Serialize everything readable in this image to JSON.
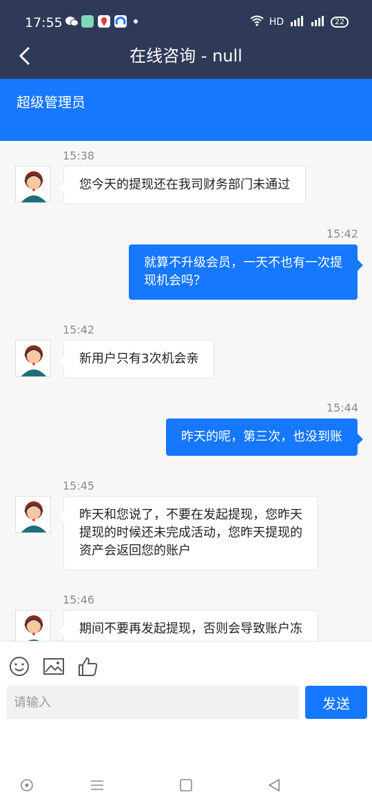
{
  "status": {
    "time": "17:55",
    "network": "HD",
    "battery": "22"
  },
  "header": {
    "title": "在线咨询 - null"
  },
  "banner": {
    "name": "超级管理员"
  },
  "messages": [
    {
      "time": "15:38",
      "text": "您今天的提现还在我司财务部门未通过",
      "dir": "in"
    },
    {
      "time": "15:42",
      "line1": "就算不升级会员，一天不也有一次提",
      "line2": "现机会吗？",
      "dir": "out"
    },
    {
      "time": "15:42",
      "text": "新用户只有3次机会亲",
      "dir": "in"
    },
    {
      "time": "15:44",
      "text": "昨天的呢，第三次，也没到账",
      "dir": "out"
    },
    {
      "time": "15:45",
      "line1": "昨天和您说了，不要在发起提现，您昨天",
      "line2": "提现的时候还未完成活动，您昨天提现的",
      "line3": "资产会返回您的账户",
      "dir": "in"
    },
    {
      "time": "15:46",
      "text": "期间不要再发起提现，否则会导致账户冻",
      "dir": "in"
    }
  ],
  "composer": {
    "placeholder": "请输入",
    "send_label": "发送"
  },
  "icons": [
    "emoji-icon",
    "image-icon",
    "thumbs-up-icon"
  ],
  "colors": {
    "header": "#2f3a58",
    "accent": "#1677ff"
  }
}
